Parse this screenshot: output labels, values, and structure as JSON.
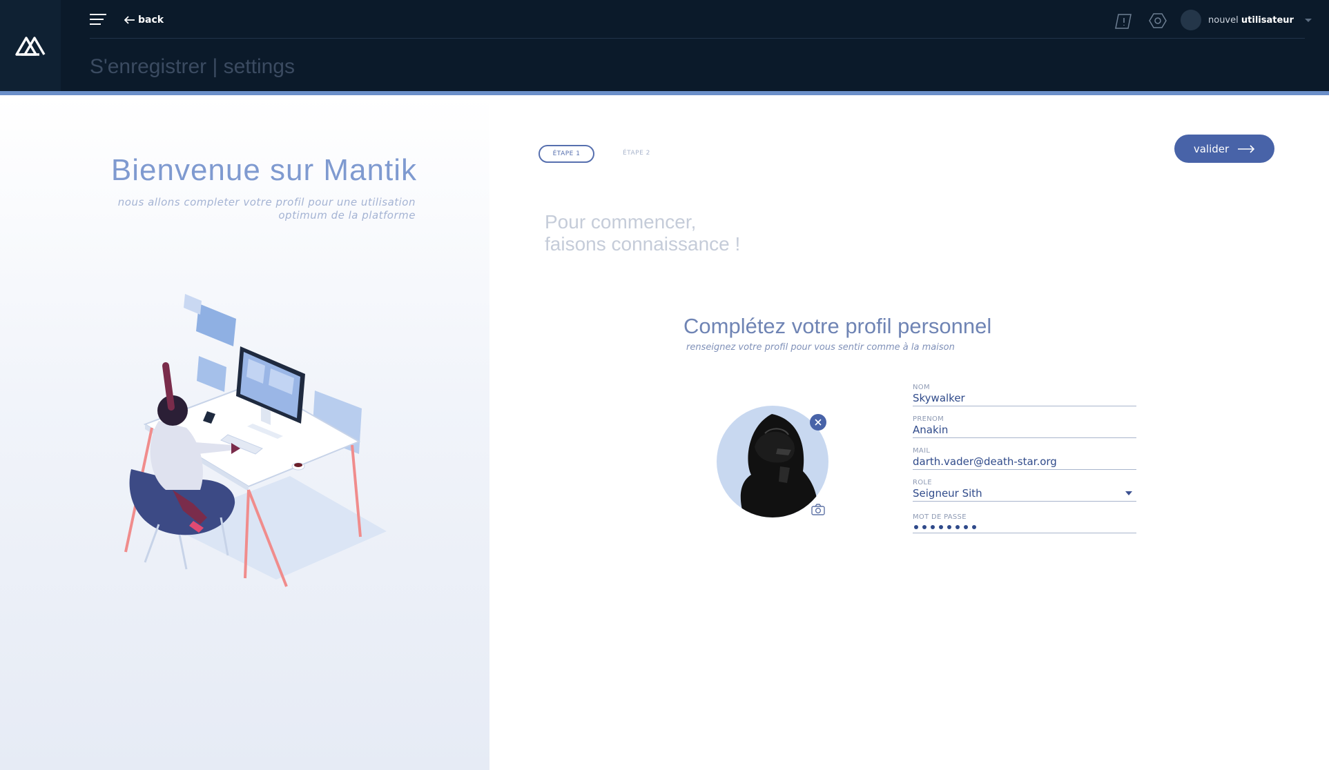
{
  "header": {
    "back_label": "back",
    "page_title": "S'enregistrer | settings",
    "user": {
      "prefix": "nouvel",
      "name": "utilisateur"
    }
  },
  "welcome": {
    "title": "Bienvenue sur Mantik",
    "subtitle_line1": "nous allons completer votre profil pour une utilisation",
    "subtitle_line2": "optimum de la platforme"
  },
  "steps": {
    "step1": "ÉTAPE 1",
    "step2": "ÉTAPE 2",
    "submit_label": "valider"
  },
  "intro": {
    "line1": "Pour commencer,",
    "line2": "faisons connaissance !"
  },
  "profile": {
    "title": "Complétez votre profil personnel",
    "subtitle": "renseignez votre profil pour vous sentir comme à la maison"
  },
  "form": {
    "nom": {
      "label": "NOM",
      "value": "Skywalker"
    },
    "prenom": {
      "label": "PRENOM",
      "value": "Anakin"
    },
    "mail": {
      "label": "MAIL",
      "value": "darth.vader@death-star.org"
    },
    "role": {
      "label": "ROLE",
      "value": "Seigneur Sith"
    },
    "password": {
      "label": "MOT DE PASSE",
      "masked_length": 8
    }
  },
  "colors": {
    "header_bg": "#0b1a2a",
    "accent": "#4863a8",
    "accent_bar": "#6b8fc9"
  },
  "icons": [
    "mantik-logo-icon",
    "hamburger-menu-icon",
    "arrow-left-icon",
    "notification-flag-icon",
    "settings-hexagon-icon",
    "chevron-down-icon",
    "arrow-right-icon",
    "close-icon",
    "camera-icon"
  ]
}
